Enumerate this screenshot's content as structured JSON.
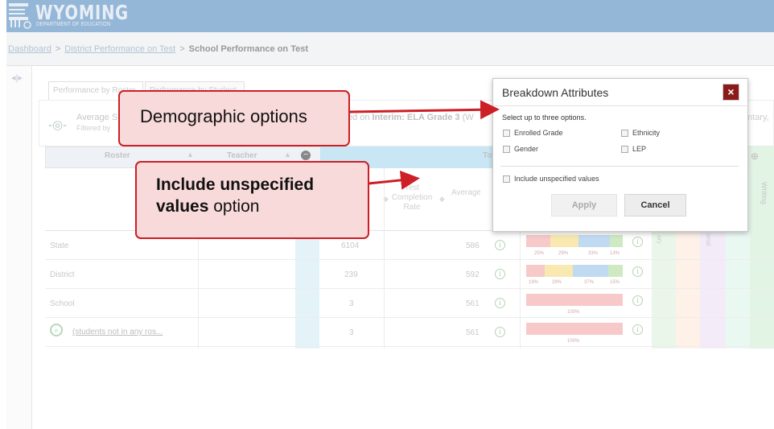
{
  "header": {
    "title": "WYOMING",
    "subtitle": "DEPARTMENT OF EDUCATION"
  },
  "breadcrumb": {
    "items": [
      "Dashboard",
      "District Performance on Test"
    ],
    "current": "School Performance on Test",
    "separator": ">"
  },
  "tabs": [
    "Performance by Roster",
    "Performance by Student"
  ],
  "summary": {
    "title_left": "Average S",
    "filter": "Filtered by",
    "title_right_prefix": "ised on ",
    "title_right_bold": "Interim: ELA Grade 3",
    "title_right_suffix": " (W",
    "right_edge": "ntary,"
  },
  "table": {
    "headers": {
      "roster": "Roster",
      "teacher": "Teacher",
      "total": "Tot",
      "test_completion": "Test Completion Rate",
      "avg_scale": "Average Scale Sco",
      "writing": "Writing",
      "col_a": "ary",
      "col_b": "onal"
    },
    "rows": [
      {
        "label": "State",
        "count": "6104",
        "score": "586",
        "pcts": [
          "25%",
          "29%",
          "33%",
          "13%"
        ]
      },
      {
        "label": "District",
        "count": "239",
        "score": "592",
        "pcts": [
          "19%",
          "29%",
          "37%",
          "15%"
        ]
      },
      {
        "label": "School",
        "count": "3",
        "score": "561",
        "pcts": [
          "100%"
        ]
      },
      {
        "label": "(students not in any ros...",
        "count": "3",
        "score": "561",
        "pcts": [
          "100%"
        ]
      }
    ]
  },
  "modal": {
    "title": "Breakdown Attributes",
    "close": "×",
    "instruction": "Select up to three options.",
    "options": [
      "Enrolled Grade",
      "Ethnicity",
      "Gender",
      "LEP"
    ],
    "include_unspecified": "Include unspecified values",
    "apply": "Apply",
    "cancel": "Cancel"
  },
  "callouts": {
    "demographic": "Demographic options",
    "unspecified_bold": "Include unspecified values",
    "unspecified_rest": " option"
  },
  "colors": {
    "accent_red": "#cc1f26",
    "header_blue": "#8fb3d5",
    "close_btn": "#8b1a1a"
  },
  "icons": [
    "logo-icon",
    "rail-toggle-icon",
    "target-icon",
    "sort-icon",
    "minus-circle-icon",
    "plus-circle-icon",
    "info-icon",
    "search-icon",
    "close-icon"
  ]
}
